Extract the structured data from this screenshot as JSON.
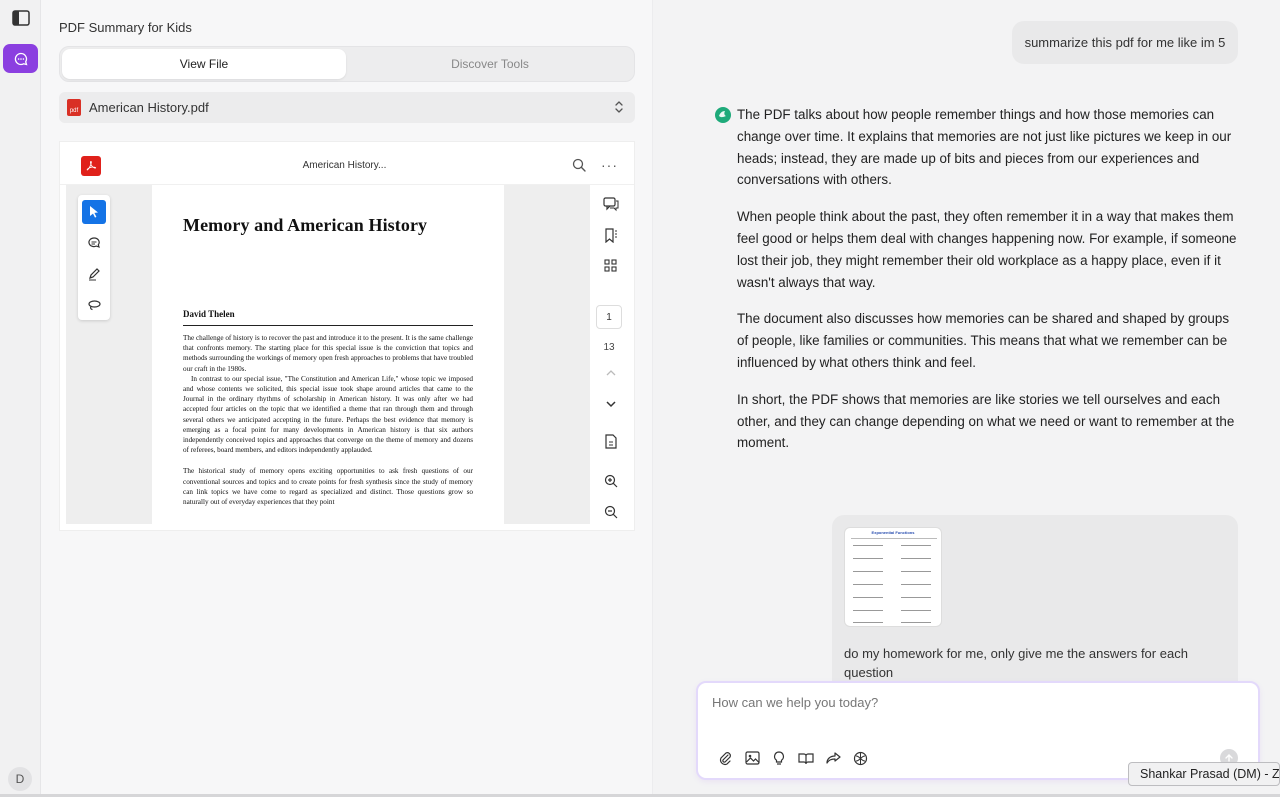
{
  "sidebar": {
    "avatar_initial": "D"
  },
  "left_panel": {
    "title": "PDF Summary for Kids",
    "tabs": [
      {
        "label": "View File",
        "active": true
      },
      {
        "label": "Discover Tools",
        "active": false
      }
    ],
    "file_select": {
      "badge": "pdf",
      "value": "American History.pdf"
    }
  },
  "viewer": {
    "doc_title": "American History...",
    "current_page": "1",
    "total_pages": "13",
    "page": {
      "title": "Memory and American History",
      "author": "David Thelen",
      "paragraphs": [
        "The challenge of history is to recover the past and introduce it to the present. It is the same challenge that confronts memory. The starting place for this special issue is the conviction that topics and methods surrounding the workings of memory open fresh approaches to problems that have troubled our craft in the 1980s.",
        "In contrast to our special issue, \"The Constitution and American Life,\" whose topic we imposed and whose contents we solicited, this special issue took shape around articles that came to the Journal in the ordinary rhythms of scholarship in American history. It was only after we had accepted four articles on the topic that we identified a theme that ran through them and through several others we anticipated accepting in the future. Perhaps the best evidence that memory is emerging as a focal point for many developments in American history is that six authors independently conceived topics and approaches that converge on the theme of memory and dozens of referees, board members, and editors independently applauded.",
        "The historical study of memory opens exciting opportunities to ask fresh questions of our conventional sources and topics and to create points for fresh synthesis since the study of memory can link topics we have come to regard as specialized and distinct. Those questions grow so naturally out of everyday experiences that they point"
      ]
    }
  },
  "chat": {
    "user_message_1": "summarize this pdf for me like im 5",
    "assistant_paragraphs": [
      "The PDF talks about how people remember things and how those memories can change over time. It explains that memories are not just like pictures we keep in our heads; instead, they are made up of bits and pieces from our experiences and conversations with others.",
      "When people think about the past, they often remember it in a way that makes them feel good or helps them deal with changes happening now. For example, if someone lost their job, they might remember their old workplace as a happy place, even if it wasn't always that way.",
      "The document also discusses how memories can be shared and shaped by groups of people, like families or communities. This means that what we remember can be influenced by what others think and feel.",
      "In short, the PDF shows that memories are like stories we tell ourselves and each other, and they can change depending on what we need or want to remember at the moment."
    ],
    "user_message_2": {
      "attachment_title": "Exponential Functions",
      "text": "do my homework for me, only give me the answers for each question"
    },
    "input": {
      "placeholder": "How can we help you today?",
      "value": ""
    }
  },
  "tooltip": "Shankar Prasad (DM) - Zoom",
  "colors": {
    "accent": "#8b3fe0",
    "pdf_red": "#e0211b",
    "select_blue": "#1473e6"
  }
}
